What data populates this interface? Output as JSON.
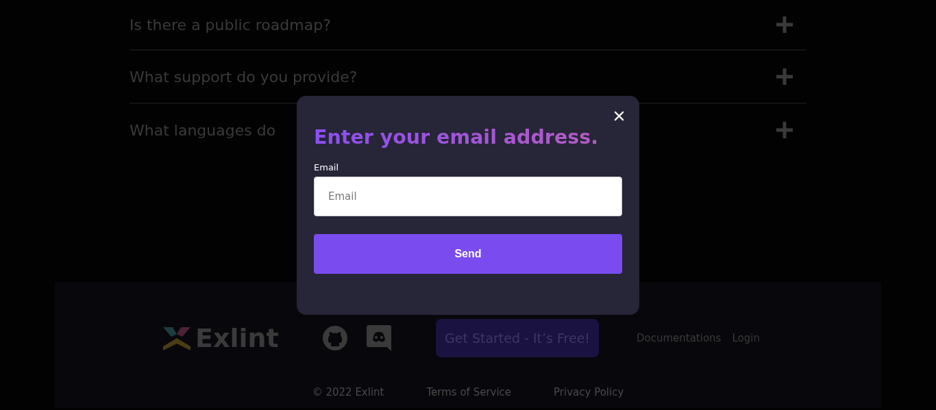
{
  "faq": [
    {
      "question": "Is there a public roadmap?",
      "expanded": false
    },
    {
      "question": "What support do you provide?",
      "expanded": false
    },
    {
      "question": "What languages do",
      "expanded": false
    }
  ],
  "modal": {
    "title": "Enter your email address.",
    "field_label": "Email",
    "placeholder": "Email",
    "button": "Send"
  },
  "footer": {
    "logo": "Exlint",
    "cta": "Get Started - It’s Free!",
    "links": [
      "Documentations",
      "Login"
    ],
    "copyright": "© 2022 Exlint",
    "legal": [
      "Terms of Service",
      "Privacy Policy"
    ]
  }
}
